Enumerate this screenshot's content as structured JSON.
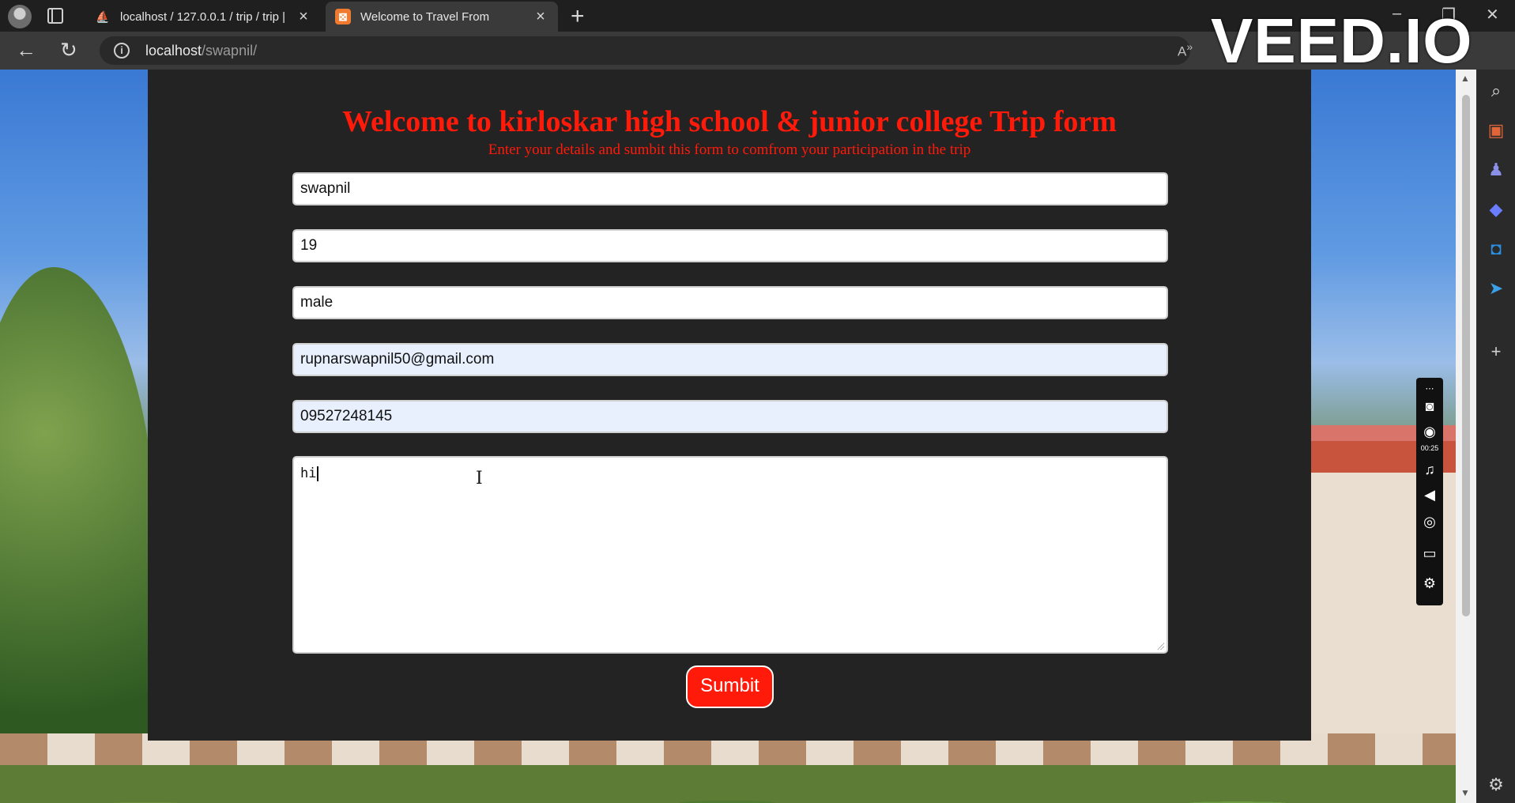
{
  "browser": {
    "tabs": [
      {
        "title": "localhost / 127.0.0.1 / trip / trip |",
        "active": false,
        "icon": "phpmyadmin-icon"
      },
      {
        "title": "Welcome to Travel From",
        "active": true,
        "icon": "xampp-icon"
      }
    ],
    "url_host": "localhost",
    "url_path": "/swapnil/",
    "watermark": "VEED.IO"
  },
  "form": {
    "heading": "Welcome to kirloskar high school & junior college Trip form",
    "subheading": "Enter your details and sumbit this form to comfrom your participation in the trip",
    "name_value": "swapnil",
    "age_value": "19",
    "gender_value": "male",
    "email_value": "rupnarswapnil50@gmail.com",
    "phone_value": "09527248145",
    "description_value": "hi",
    "submit_label": "Sumbit"
  },
  "recorder": {
    "elapsed": "00:25"
  },
  "colors": {
    "accent_red": "#ff1a0a",
    "card_bg": "#232323",
    "autofill_bg": "#e8f0fe"
  }
}
